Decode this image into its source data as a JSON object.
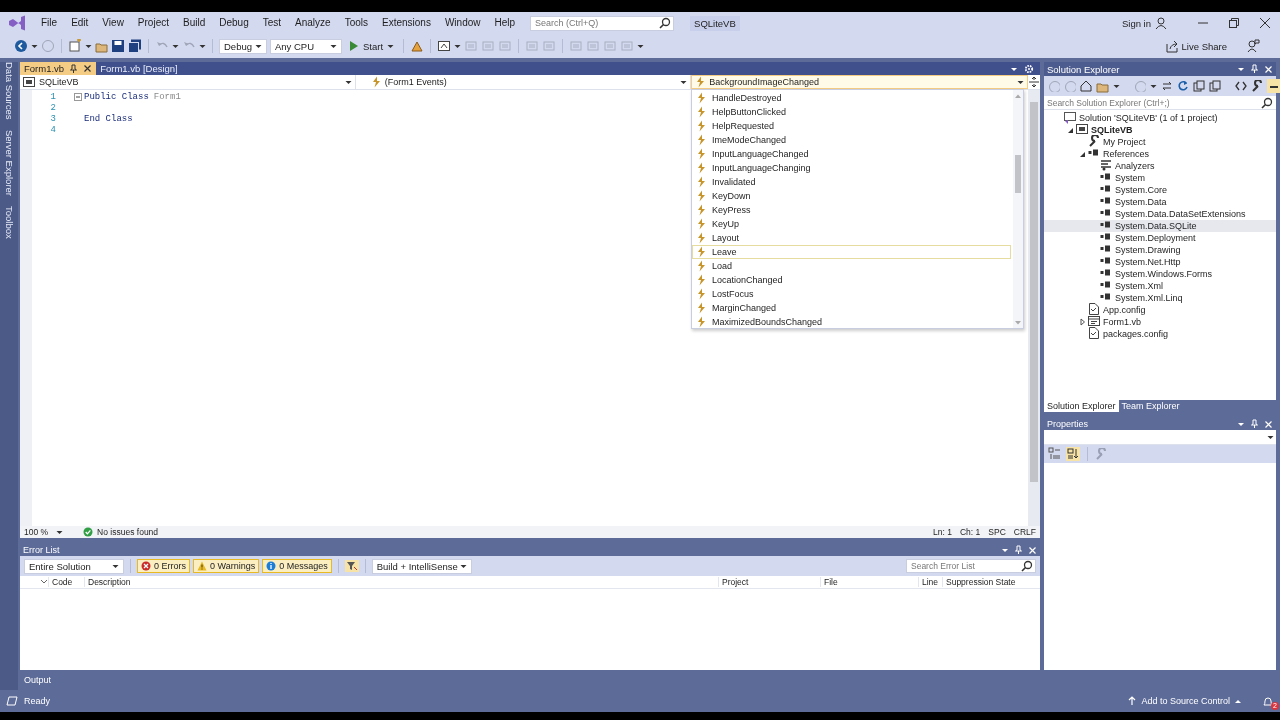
{
  "menu": [
    "File",
    "Edit",
    "View",
    "Project",
    "Build",
    "Debug",
    "Test",
    "Analyze",
    "Tools",
    "Extensions",
    "Window",
    "Help"
  ],
  "search": {
    "placeholder": "Search (Ctrl+Q)"
  },
  "solution_name": "SQLiteVB",
  "account": "Sign in",
  "toolbar": {
    "configuration": "Debug",
    "platform": "Any CPU",
    "start": "Start"
  },
  "live_share": "Live Share",
  "side_tabs": [
    "Data Sources",
    "Server Explorer",
    "Toolbox"
  ],
  "doc_tabs": [
    {
      "label": "Form1.vb",
      "selected": true
    },
    {
      "label": "Form1.vb [Design]",
      "selected": false
    }
  ],
  "nav_bar": {
    "project": "SQLiteVB",
    "object": "(Form1 Events)",
    "member": "BackgroundImageChanged"
  },
  "code_lines": [
    {
      "number": "1",
      "tokens": [
        {
          "text": "Public Class",
          "kind": "keyword"
        },
        {
          "text": "Form1",
          "kind": "identifier"
        }
      ]
    },
    {
      "number": "2"
    },
    {
      "number": "3",
      "tokens": [
        {
          "text": "End Class",
          "kind": "keyword"
        }
      ]
    },
    {
      "number": "4"
    }
  ],
  "member_dropdown": [
    {
      "label": "HandleDestroyed",
      "selected": false
    },
    {
      "label": "HelpButtonClicked",
      "selected": false
    },
    {
      "label": "HelpRequested",
      "selected": false
    },
    {
      "label": "ImeModeChanged",
      "selected": false
    },
    {
      "label": "InputLanguageChanged",
      "selected": false
    },
    {
      "label": "InputLanguageChanging",
      "selected": false
    },
    {
      "label": "Invalidated",
      "selected": false
    },
    {
      "label": "KeyDown",
      "selected": false
    },
    {
      "label": "KeyPress",
      "selected": false
    },
    {
      "label": "KeyUp",
      "selected": false
    },
    {
      "label": "Layout",
      "selected": false
    },
    {
      "label": "Leave",
      "selected": true
    },
    {
      "label": "Load",
      "selected": false
    },
    {
      "label": "LocationChanged",
      "selected": false
    },
    {
      "label": "LostFocus",
      "selected": false
    },
    {
      "label": "MarginChanged",
      "selected": false
    },
    {
      "label": "MaximizedBoundsChanged",
      "selected": false
    }
  ],
  "editor_status": {
    "zoom": "100 %",
    "issues": "No issues found",
    "line": "Ln: 1",
    "column": "Ch: 1",
    "whitespace": "SPC",
    "line_ending": "CRLF"
  },
  "error_list": {
    "title": "Error List",
    "scope": "Entire Solution",
    "filters": [
      {
        "label": "0 Errors",
        "kind": "error",
        "on": true
      },
      {
        "label": "0 Warnings",
        "kind": "warning",
        "on": true
      },
      {
        "label": "0 Messages",
        "kind": "message",
        "on": true
      }
    ],
    "build_filter": "Build + IntelliSense",
    "search": {
      "placeholder": "Search Error List"
    },
    "columns": [
      "Code",
      "Description",
      "Project",
      "File",
      "Line",
      "Suppression State"
    ]
  },
  "output_tab": "Output",
  "status_bar": {
    "text": "Ready",
    "source_control": "Add to Source Control",
    "notifications": "2"
  },
  "solution_explorer": {
    "title": "Solution Explorer",
    "search": {
      "placeholder": "Search Solution Explorer (Ctrl+;)"
    },
    "tree": [
      {
        "label": "Solution 'SQLiteVB' (1 of 1 project)",
        "kind": "solution",
        "selected": false,
        "children": [
          {
            "label": "SQLiteVB",
            "kind": "project",
            "selected": false,
            "expanded": true,
            "children": [
              {
                "label": "My Project",
                "kind": "wrench",
                "selected": false
              },
              {
                "label": "References",
                "kind": "references",
                "selected": false,
                "expanded": true,
                "children": [
                  {
                    "label": "Analyzers",
                    "kind": "analyzers",
                    "selected": false
                  },
                  {
                    "label": "System",
                    "kind": "reference",
                    "selected": false
                  },
                  {
                    "label": "System.Core",
                    "kind": "reference",
                    "selected": false
                  },
                  {
                    "label": "System.Data",
                    "kind": "reference",
                    "selected": false
                  },
                  {
                    "label": "System.Data.DataSetExtensions",
                    "kind": "reference",
                    "selected": false
                  },
                  {
                    "label": "System.Data.SQLite",
                    "kind": "reference",
                    "selected": true
                  },
                  {
                    "label": "System.Deployment",
                    "kind": "reference",
                    "selected": false
                  },
                  {
                    "label": "System.Drawing",
                    "kind": "reference",
                    "selected": false
                  },
                  {
                    "label": "System.Net.Http",
                    "kind": "reference",
                    "selected": false
                  },
                  {
                    "label": "System.Windows.Forms",
                    "kind": "reference",
                    "selected": false
                  },
                  {
                    "label": "System.Xml",
                    "kind": "reference",
                    "selected": false
                  },
                  {
                    "label": "System.Xml.Linq",
                    "kind": "reference",
                    "selected": false
                  }
                ]
              },
              {
                "label": "App.config",
                "kind": "config",
                "selected": false
              },
              {
                "label": "Form1.vb",
                "kind": "form",
                "selected": false,
                "expanded": false
              },
              {
                "label": "packages.config",
                "kind": "config",
                "selected": false
              }
            ]
          }
        ]
      }
    ],
    "tabs": [
      {
        "label": "Solution Explorer",
        "selected": true
      },
      {
        "label": "Team Explorer",
        "selected": false
      }
    ]
  },
  "properties": {
    "title": "Properties"
  }
}
